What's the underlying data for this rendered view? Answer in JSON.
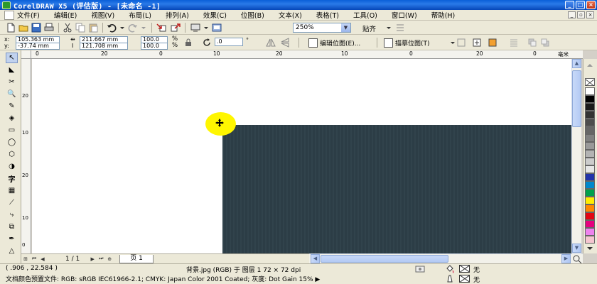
{
  "window": {
    "title": "CorelDRAW X5 (评估版) - [未命名 -1]",
    "controls": [
      "minimize",
      "maximize",
      "close"
    ]
  },
  "menu": {
    "items": [
      "文件(F)",
      "编辑(E)",
      "视图(V)",
      "布局(L)",
      "排列(A)",
      "效果(C)",
      "位图(B)",
      "文本(X)",
      "表格(T)",
      "工具(O)",
      "窗口(W)",
      "帮助(H)"
    ]
  },
  "toolbar": {
    "zoom_value": "250%",
    "snap_label": "贴齐"
  },
  "properties": {
    "x_label": "x:",
    "x_value": "105.363 mm",
    "y_label": "y:",
    "y_value": "-37.74 mm",
    "width_value": "211.667 mm",
    "height_value": "121.708 mm",
    "scale_x": "100.0",
    "scale_y": "100.0",
    "scale_unit": "%",
    "rotation": ".0",
    "edit_bitmap_label": "编辑位图(E)...",
    "trace_bitmap_label": "描摹位图(T)"
  },
  "rulers": {
    "top_ticks": [
      "0",
      "20",
      "0",
      "10",
      "20",
      "10",
      "0",
      "20",
      "0",
      "毫米"
    ],
    "left_ticks": [
      "20",
      "10",
      "20",
      "10",
      "0"
    ]
  },
  "pages": {
    "counter": "1 / 1",
    "tab_label": "页 1"
  },
  "status": {
    "coordinates": "( .906 , 22.584 )",
    "object_info": "背景.jpg (RGB) 于 图层 1 72 × 72 dpi",
    "color_profile": "文档颜色预置文件: RGB: sRGB IEC61966-2.1; CMYK: Japan Color 2001 Coated; 灰度: Dot Gain 15% ▶",
    "fill_none": "无",
    "outline_none": "无"
  },
  "palette": {
    "colors": [
      "#ffffff",
      "#000000",
      "#1a1a1a",
      "#333333",
      "#4d4d4d",
      "#666666",
      "#808080",
      "#999999",
      "#b3b3b3",
      "#cccccc",
      "#e6e6e6",
      "#2233aa",
      "#0088cc",
      "#00a14b",
      "#ffed00",
      "#ff8800",
      "#e30613",
      "#e6007e",
      "#ee82ee",
      "#f5c6d0"
    ]
  },
  "canvas": {
    "bitmap_color": "#2d3f48",
    "highlight_color": "#fff600"
  }
}
